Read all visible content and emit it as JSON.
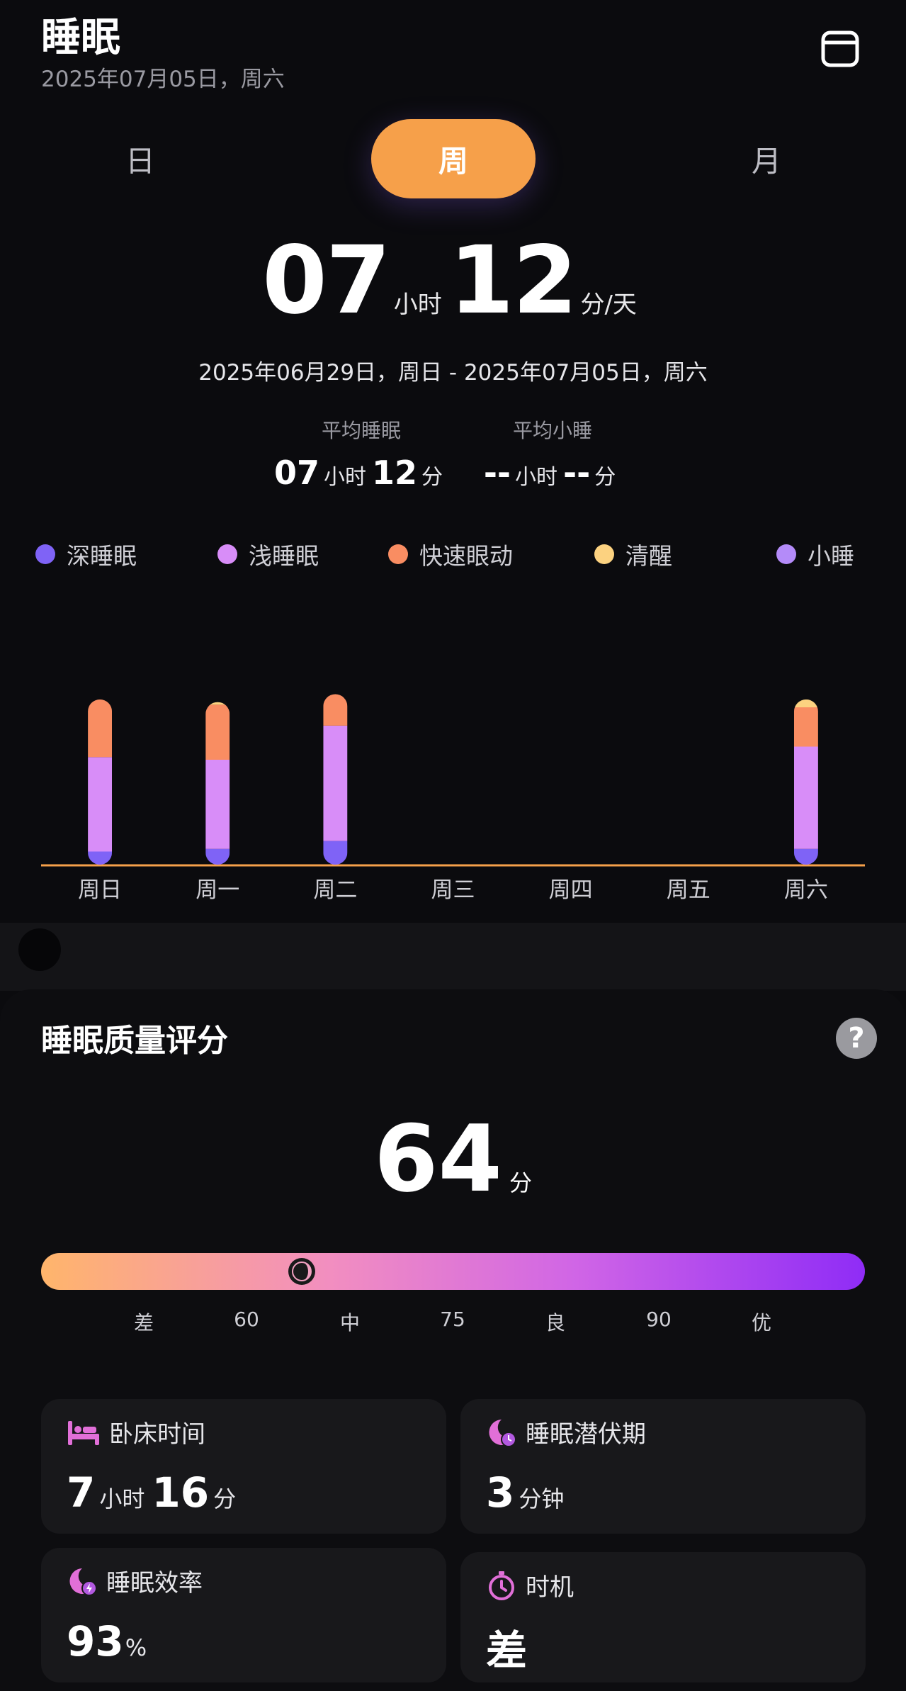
{
  "header": {
    "title": "睡眠",
    "date": "2025年07月05日，周六",
    "calendar_icon": "calendar-icon"
  },
  "tabs": [
    {
      "label": "日",
      "active": false
    },
    {
      "label": "周",
      "active": true
    },
    {
      "label": "月",
      "active": false
    }
  ],
  "summary": {
    "hours": "07",
    "hours_unit": "小时",
    "minutes": "12",
    "minutes_unit": "分/天",
    "range": "2025年06月29日，周日 - 2025年07月05日，周六"
  },
  "averages": {
    "sleep_label": "平均睡眠",
    "sleep_hours": "07",
    "sleep_hours_unit": "小时",
    "sleep_minutes": "12",
    "sleep_minutes_unit": "分",
    "nap_label": "平均小睡",
    "nap_hours": "--",
    "nap_hours_unit": "小时",
    "nap_minutes": "--",
    "nap_minutes_unit": "分"
  },
  "legend": [
    {
      "label": "深睡眠",
      "color": "#7f63f6"
    },
    {
      "label": "浅睡眠",
      "color": "#d88df8"
    },
    {
      "label": "快速眼动",
      "color": "#f98d62"
    },
    {
      "label": "清醒",
      "color": "#fcd280"
    },
    {
      "label": "小睡",
      "color": "#b48bf9"
    }
  ],
  "chart_data": {
    "type": "bar",
    "stacked": true,
    "categories": [
      "周日",
      "周一",
      "周二",
      "周三",
      "周四",
      "周五",
      "周六"
    ],
    "series": [
      {
        "name": "深睡眠",
        "color": "#7f63f6",
        "values": [
          0.5,
          0.6,
          0.9,
          0,
          0,
          0,
          0.6
        ]
      },
      {
        "name": "浅睡眠",
        "color": "#d88df8",
        "values": [
          3.6,
          3.4,
          4.4,
          0,
          0,
          0,
          3.9
        ]
      },
      {
        "name": "快速眼动",
        "color": "#f98d62",
        "values": [
          2.2,
          2.1,
          1.2,
          0,
          0,
          0,
          1.5
        ]
      },
      {
        "name": "清醒",
        "color": "#fcd280",
        "values": [
          0,
          0.1,
          0,
          0,
          0,
          0,
          0.3
        ]
      }
    ],
    "ylim": [
      0,
      10
    ],
    "grid": false
  },
  "quality": {
    "title": "睡眠质量评分",
    "help_icon": "help-icon",
    "score": "64",
    "score_unit": "分",
    "score_value": 64,
    "scale_min": 45,
    "scale_max": 105,
    "ticks": [
      "差",
      "60",
      "中",
      "75",
      "良",
      "90",
      "优"
    ]
  },
  "metrics": [
    {
      "label": "卧床时间",
      "icon": "bed-icon",
      "parts": [
        {
          "num": "7",
          "unit": "小时"
        },
        {
          "num": "16",
          "unit": "分"
        }
      ]
    },
    {
      "label": "睡眠潜伏期",
      "icon": "moon-clock-icon",
      "parts": [
        {
          "num": "3",
          "unit": "分钟"
        }
      ]
    },
    {
      "label": "睡眠效率",
      "icon": "moon-bolt-icon",
      "parts": [
        {
          "num": "93",
          "unit": "%"
        }
      ]
    },
    {
      "label": "时机",
      "icon": "stopwatch-icon",
      "parts": [
        {
          "num": "差",
          "unit": ""
        }
      ]
    }
  ]
}
